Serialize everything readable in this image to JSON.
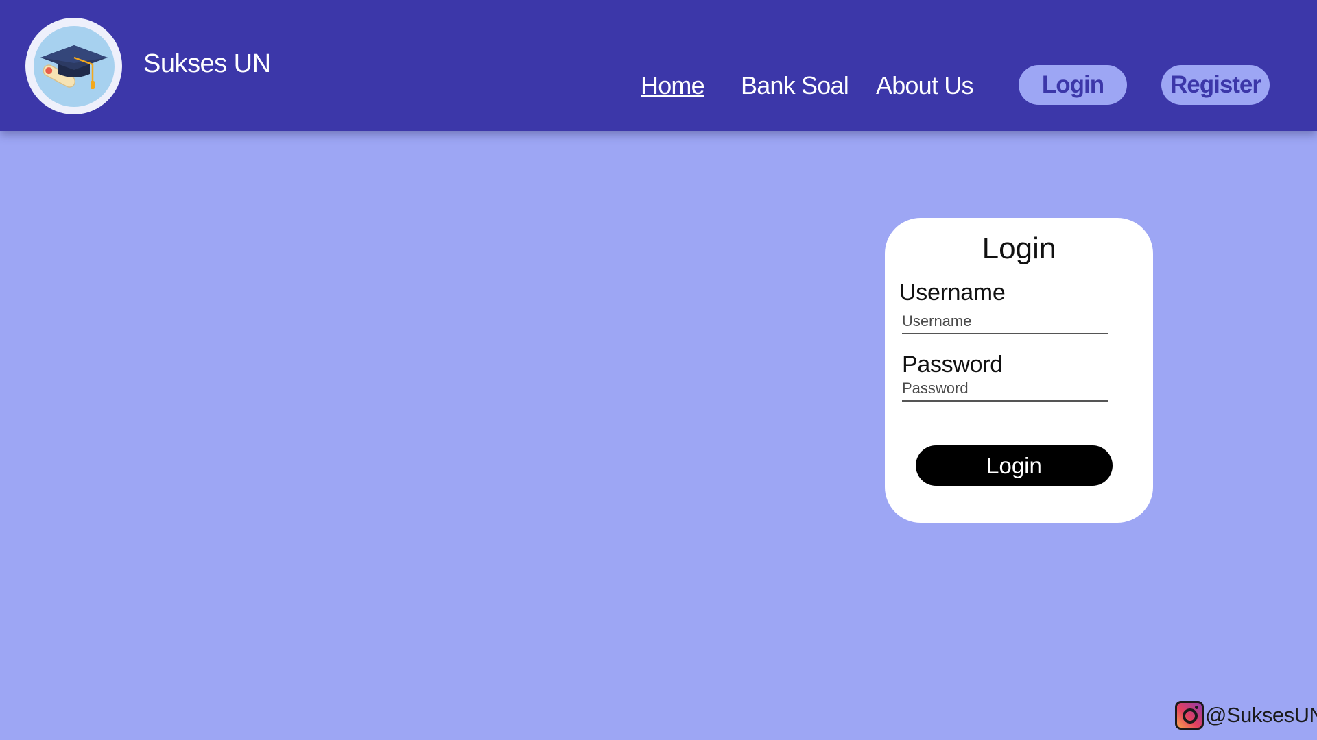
{
  "header": {
    "brand": "Sukses UN",
    "nav": {
      "home": "Home",
      "bank_soal": "Bank Soal",
      "about_us": "About Us"
    },
    "login_button": "Login",
    "register_button": "Register"
  },
  "login_card": {
    "title": "Login",
    "username_label": "Username",
    "username_placeholder": "Username",
    "password_label": "Password",
    "password_placeholder": "Password",
    "submit_label": "Login"
  },
  "footer": {
    "instagram_handle": "@SuksesUN"
  },
  "icons": {
    "logo": "graduation-cap-icon",
    "social": "instagram-icon"
  },
  "colors": {
    "navbar": "#3c37a9",
    "background": "#9da6f4",
    "card": "#ffffff",
    "button": "#000000"
  }
}
